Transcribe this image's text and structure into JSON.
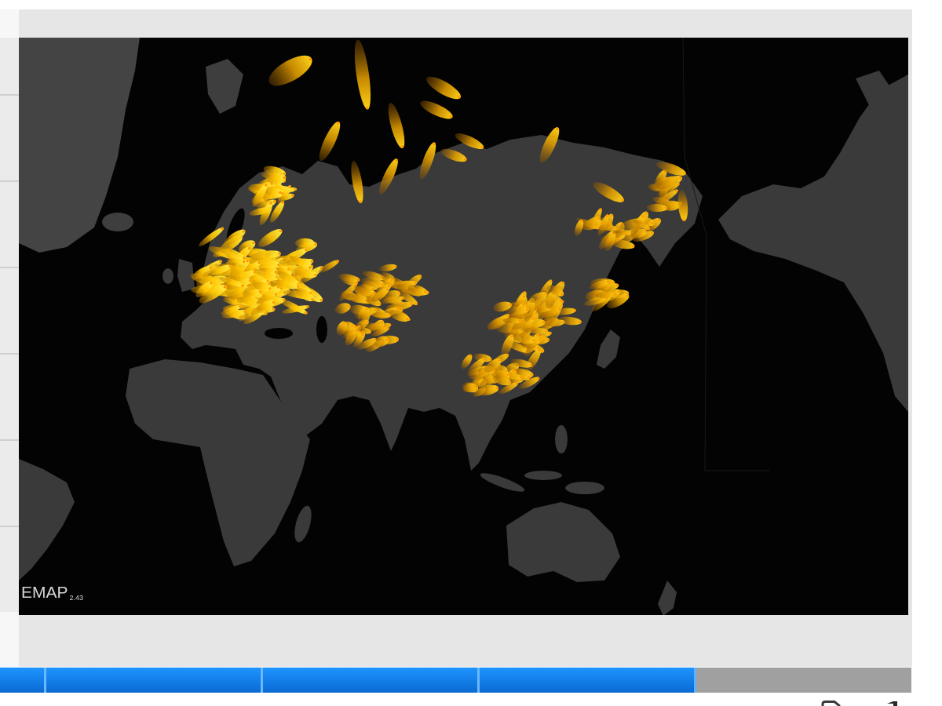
{
  "map": {
    "caption": "EMAP$_{2.43}$"
  },
  "player": {
    "progress": {
      "level": 0.764
    }
  }
}
